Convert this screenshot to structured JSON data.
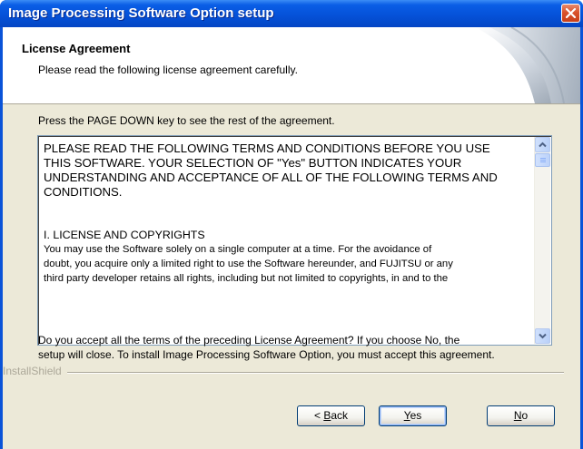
{
  "window": {
    "title": "Image Processing Software Option setup"
  },
  "header": {
    "title": "License Agreement",
    "subtitle": "Please read the following license agreement carefully."
  },
  "instruction": "Press the PAGE DOWN key to see the rest of the agreement.",
  "license": {
    "intro": "PLEASE READ THE FOLLOWING TERMS AND CONDITIONS BEFORE YOU USE\nTHIS SOFTWARE. YOUR SELECTION OF \"Yes\" BUTTON INDICATES YOUR\nUNDERSTANDING AND ACCEPTANCE OF ALL OF THE FOLLOWING TERMS AND\nCONDITIONS.",
    "section_title": "I. LICENSE AND COPYRIGHTS",
    "section_body": " You may use the Software solely on a single computer at a time. For the avoidance of\ndoubt, you acquire only a limited right to use the Software hereunder, and FUJITSU or any\nthird party developer retains all rights, including but not limited to copyrights, in and to the"
  },
  "question": "Do you accept all the terms of the preceding License Agreement?  If you choose No,  the\nsetup will close.  To install Image Processing Software Option, you must accept this agreement.",
  "footer": {
    "brand": "InstallShield"
  },
  "buttons": {
    "back_pre": "< ",
    "back_ul": "B",
    "back_post": "ack",
    "yes_ul": "Y",
    "yes_post": "es",
    "no_ul": "N",
    "no_post": "o"
  },
  "icons": {
    "close": "close-icon",
    "scroll_up": "chevron-up-icon",
    "scroll_down": "chevron-down-icon"
  },
  "colors": {
    "titlebar": "#0552d9",
    "close_button": "#d9532c",
    "dialog_background": "#ece9d8",
    "button_border": "#003c74"
  }
}
